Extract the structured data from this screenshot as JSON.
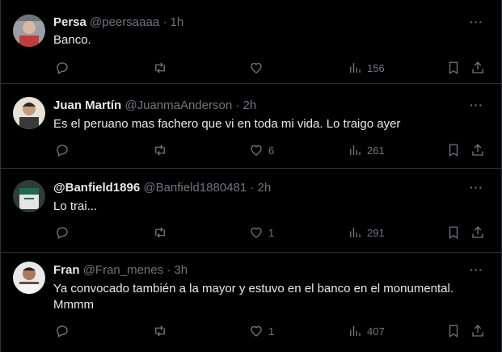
{
  "tweets": [
    {
      "name": "Persa",
      "handle": "@peersaaaa",
      "time": "1h",
      "text": "Banco.",
      "replies": "",
      "retweets": "",
      "likes": "",
      "views": "156",
      "avatar_colors": [
        "#9aa0a6",
        "#c23b3b"
      ]
    },
    {
      "name": "Juan Martín",
      "handle": "@JuanmaAnderson",
      "time": "2h",
      "text": "Es el peruano mas fachero que vi en toda mi vida. Lo traigo ayer",
      "replies": "",
      "retweets": "",
      "likes": "6",
      "views": "261",
      "avatar_colors": [
        "#e8e2d6",
        "#3a3a3a"
      ]
    },
    {
      "name": "@Banfield1896",
      "handle": "@Banfield1880481",
      "time": "2h",
      "text": "Lo trai...",
      "replies": "",
      "retweets": "",
      "likes": "1",
      "views": "291",
      "avatar_colors": [
        "#2c3e35",
        "#1f6b4d"
      ]
    },
    {
      "name": "Fran",
      "handle": "@Fran_menes",
      "time": "3h",
      "text": "Ya convocado también a la mayor y estuvo en el banco en el monumental. Mmmm",
      "replies": "",
      "retweets": "",
      "likes": "1",
      "views": "407",
      "avatar_colors": [
        "#e9e9e9",
        "#6b4b3a"
      ]
    }
  ],
  "separator": "·",
  "more_label": "···"
}
